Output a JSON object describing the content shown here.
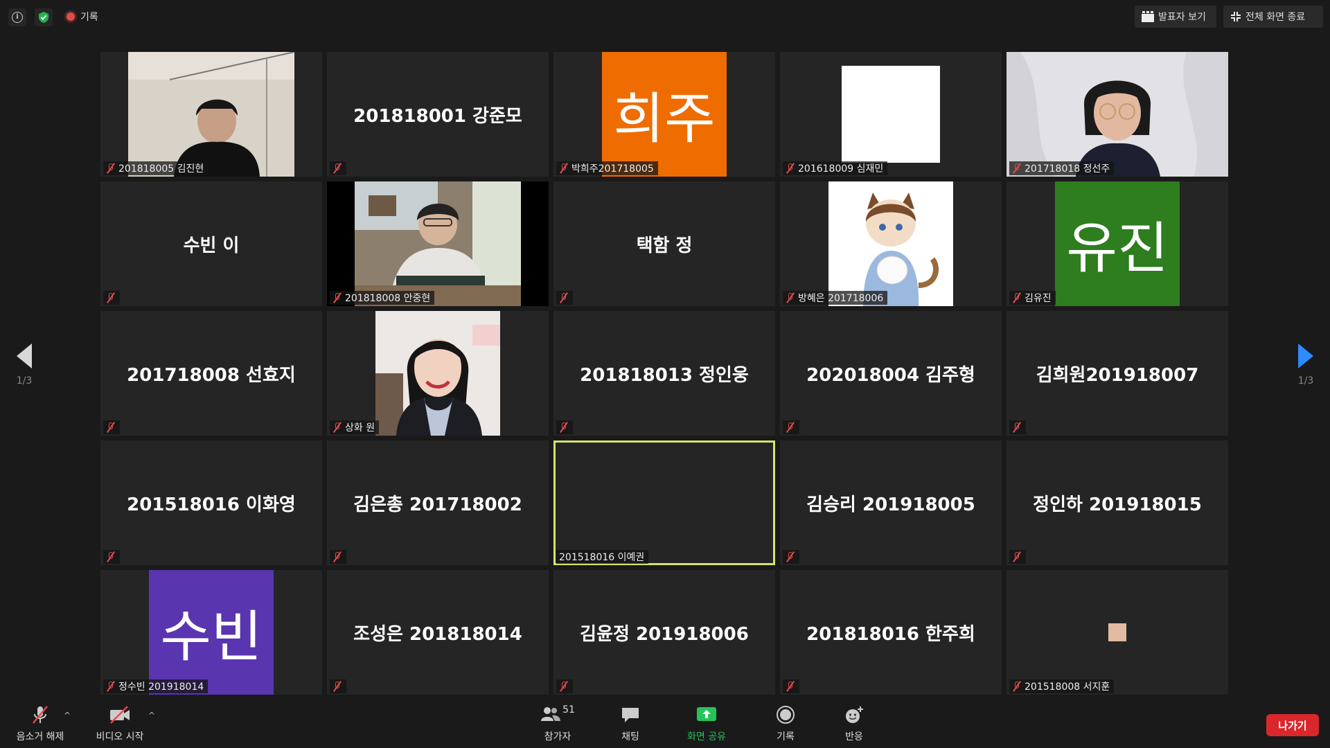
{
  "topbar": {
    "record_label": "기록",
    "speaker_view": "발표자 보기",
    "exit_fullscreen": "전체 화면 종료"
  },
  "pages": {
    "left": "1/3",
    "right": "1/3"
  },
  "tiles": [
    {
      "label": "201818005 김진현"
    },
    {
      "center": "201818001 강준모"
    },
    {
      "avatar": "희주",
      "label": "박희주201718005",
      "color": "#ef6c00"
    },
    {
      "label": "201618009 심재민"
    },
    {
      "label": "201718018 정선주"
    },
    {
      "center": "수빈 이"
    },
    {
      "label": "201818008 안중현"
    },
    {
      "center": "택함 정"
    },
    {
      "label": "방혜은 201718006"
    },
    {
      "avatar": "유진",
      "label": "김유진",
      "color": "#2e7d1f"
    },
    {
      "center": "201718008 선효지"
    },
    {
      "label": "상화 원"
    },
    {
      "center": "201818013 정인웅"
    },
    {
      "center": "202018004 김주형"
    },
    {
      "center": "김희원201918007"
    },
    {
      "center": "201518016 이화영"
    },
    {
      "center": "김은총 201718002"
    },
    {
      "label": "201518016 이예권"
    },
    {
      "center": "김승리 201918005"
    },
    {
      "center": "정인하 201918015"
    },
    {
      "avatar": "수빈",
      "label": "정수빈 201918014",
      "color": "#5935b0"
    },
    {
      "center": "조성은 201818014"
    },
    {
      "center": "김윤정 201918006"
    },
    {
      "center": "201818016 한주희"
    },
    {
      "label": "201518008 서지훈"
    }
  ],
  "toolbar": {
    "unmute": "음소거 해제",
    "start_video": "비디오 시작",
    "participants": "참가자",
    "participants_count": "51",
    "chat": "채팅",
    "share_screen": "화면 공유",
    "record": "기록",
    "reactions": "반응",
    "leave": "나가기"
  }
}
